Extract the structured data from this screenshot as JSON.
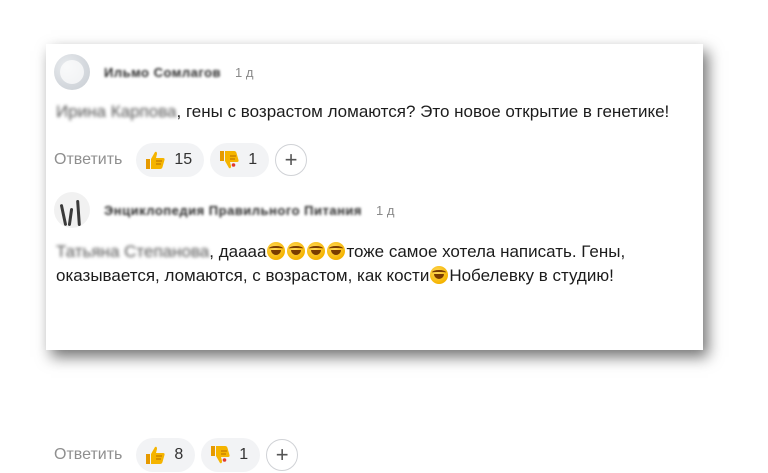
{
  "colors": {
    "reply": "#8f8f8f",
    "pill_bg": "#f2f3f5",
    "thumb": "#f5b400"
  },
  "comments": [
    {
      "author": "Ильмо Сомлагов",
      "date": "1 д",
      "mention": "Ирина Карпова",
      "text": ", гены с возрастом ломаются? Это новое открытие в генетике!",
      "reply_label": "Ответить",
      "likes": "15",
      "dislikes": "1",
      "add_label": "+"
    },
    {
      "author": "Энциклопедия Правильного Питания",
      "date": "1 д",
      "mention": "Татьяна Степанова",
      "text_part1": ", даааа",
      "text_part2": "тоже самое хотела написать. Гены, оказывается, ломаются, с возрастом, как кости",
      "text_part3": "Нобелевку в студию!",
      "reply_label": "Ответить",
      "likes": "8",
      "dislikes": "1",
      "add_label": "+"
    }
  ]
}
